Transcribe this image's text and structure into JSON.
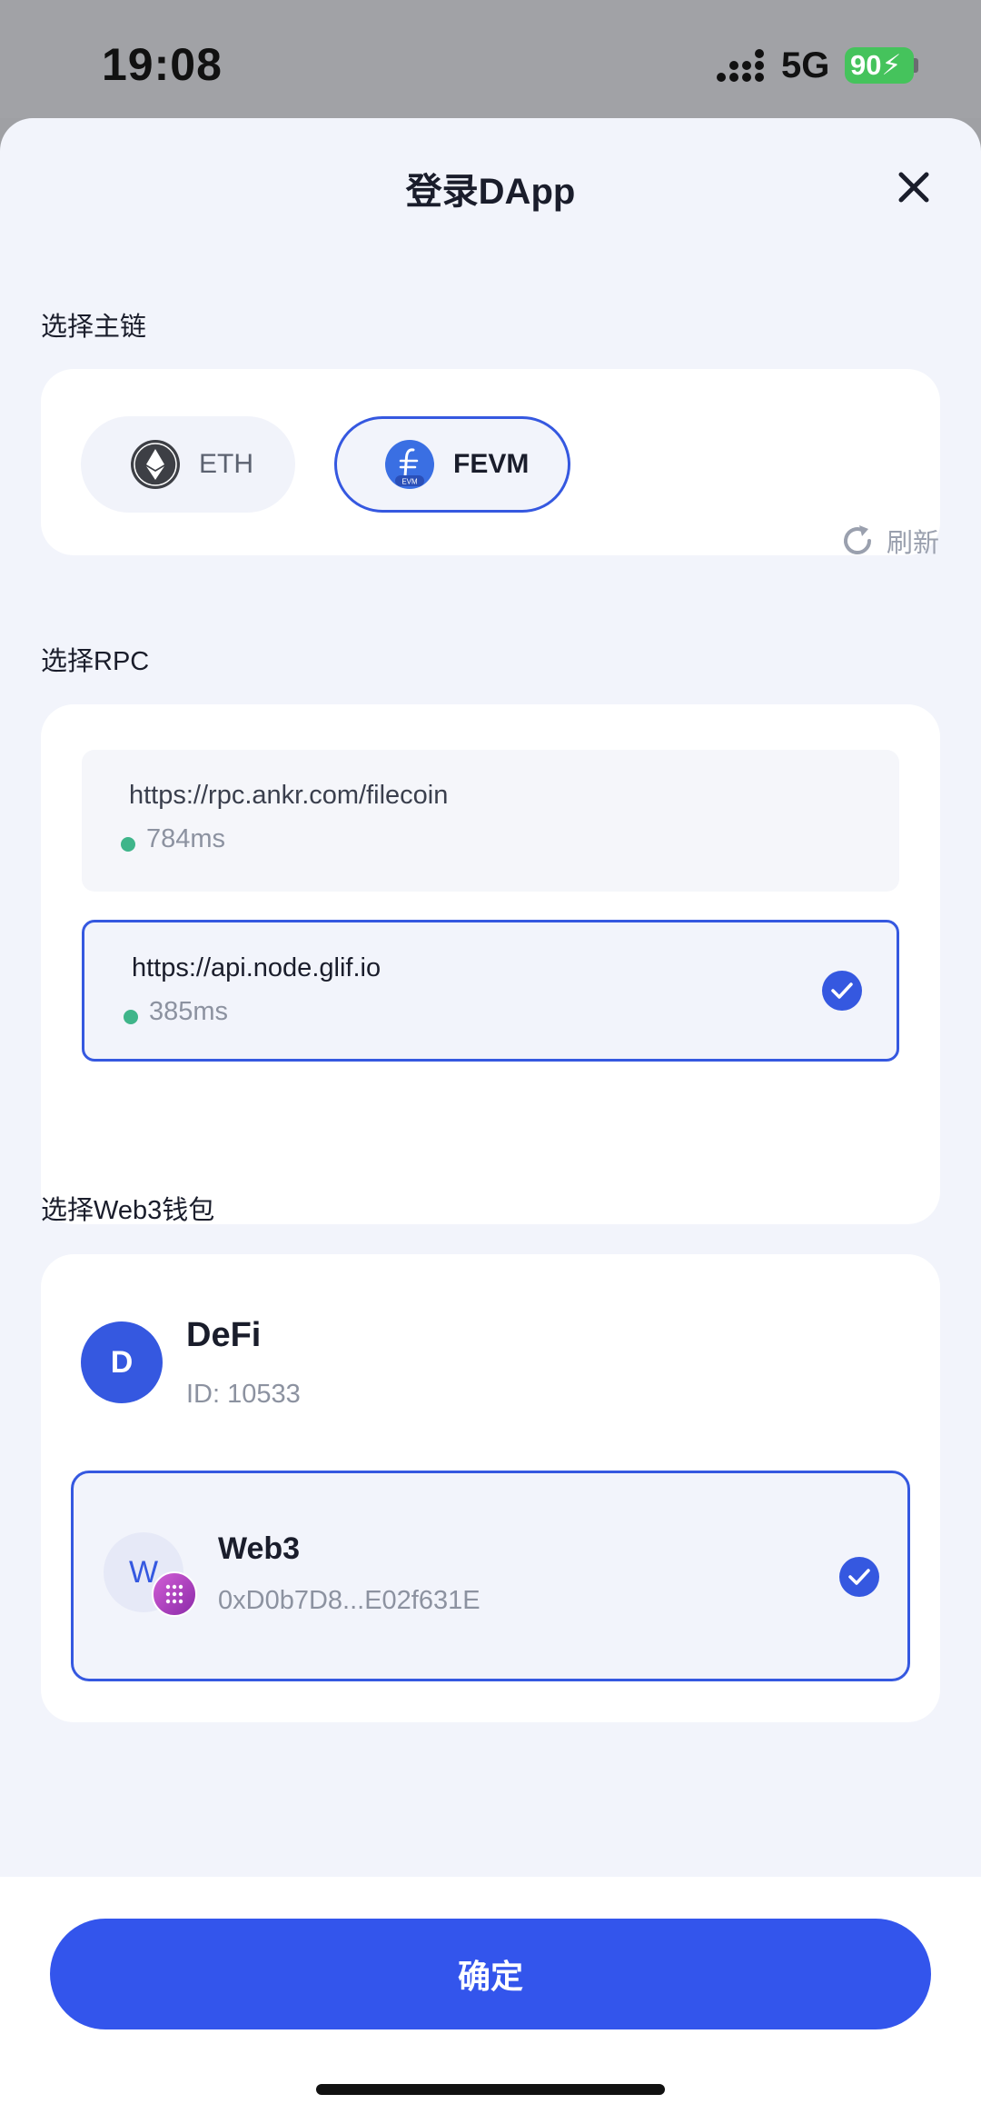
{
  "status_bar": {
    "time": "19:08",
    "network": "5G",
    "battery": "90"
  },
  "sheet": {
    "title": "登录DApp",
    "close_icon": "close-icon"
  },
  "chain_section": {
    "label": "选择主链",
    "chains": [
      {
        "label": "ETH",
        "icon": "ethereum-icon",
        "selected": false
      },
      {
        "label": "FEVM",
        "icon": "filecoin-evm-icon",
        "selected": true,
        "icon_caption": "EVM"
      }
    ]
  },
  "rpc_section": {
    "label": "选择RPC",
    "refresh_label": "刷新",
    "items": [
      {
        "url": "https://rpc.ankr.com/filecoin",
        "latency": "784ms",
        "selected": false
      },
      {
        "url": "https://api.node.glif.io",
        "latency": "385ms",
        "selected": true
      }
    ]
  },
  "wallet_section": {
    "label": "选择Web3钱包",
    "wallet": {
      "avatar_letter": "D",
      "name": "DeFi",
      "id": "ID: 10533"
    },
    "account": {
      "avatar_letter": "W",
      "name": "Web3",
      "address": "0xD0b7D8...E02f631E",
      "selected": true
    }
  },
  "footer": {
    "confirm_label": "确定"
  },
  "colors": {
    "accent": "#3558e0",
    "button": "#3355ec",
    "latency_ok": "#3fb58a",
    "sheet_bg": "#f2f4fb",
    "battery": "#45c35c"
  }
}
